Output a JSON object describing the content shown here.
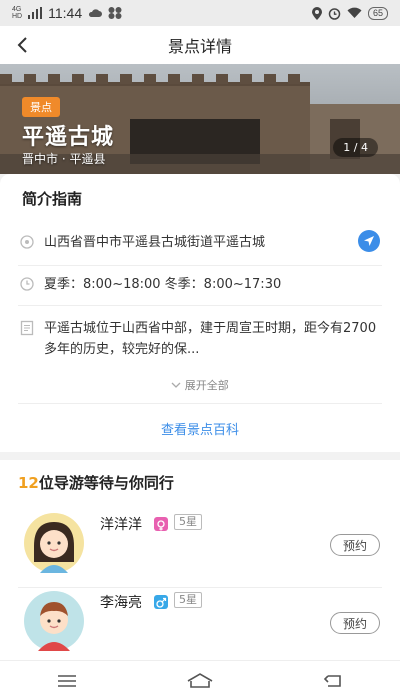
{
  "statusbar": {
    "network": "4G HD",
    "time": "11:44",
    "battery": "65"
  },
  "navbar": {
    "title": "景点详情"
  },
  "hero": {
    "tag": "景点",
    "name": "平遥古城",
    "region": "晋中市 · 平遥县",
    "pager": "1 / 4"
  },
  "intro": {
    "title": "简介指南",
    "address": "山西省晋中市平遥县古城街道平遥古城",
    "hours": "夏季：8:00~18:00  冬季：8:00~17:30",
    "description": "平遥古城位于山西省中部，建于周宣王时期，距今有2700多年的历史，较完好的保...",
    "expand_label": "展开全部",
    "wiki_link": "查看景点百科"
  },
  "guides": {
    "count": "12",
    "title_suffix": "位导游等待与你同行",
    "items": [
      {
        "name": "洋洋洋",
        "gender": "female",
        "stars": "5星",
        "book_label": "预约"
      },
      {
        "name": "李海亮",
        "gender": "male",
        "stars": "5星",
        "book_label": "预约"
      }
    ]
  },
  "colors": {
    "accent_blue": "#3b8de8",
    "tag_orange": "#f08a2a",
    "count_gold": "#f0a020",
    "female_pink": "#e860b0",
    "male_blue": "#38a8e8"
  }
}
